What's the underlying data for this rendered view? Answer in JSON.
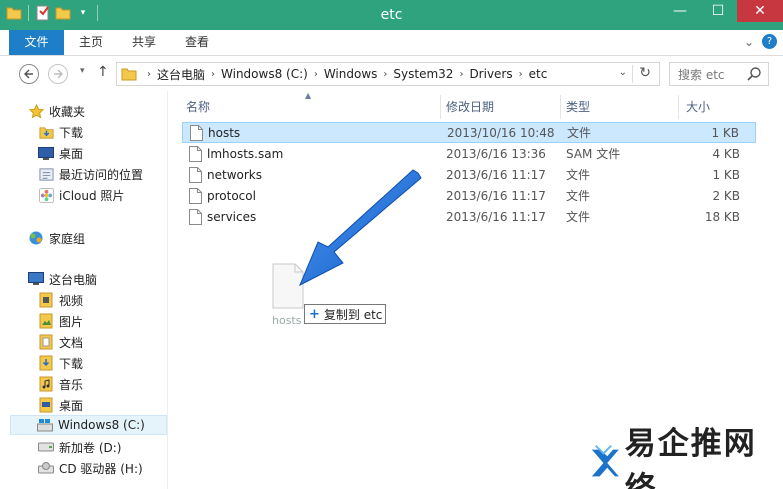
{
  "window": {
    "title": "etc",
    "minimize": "—",
    "maximize": "☐",
    "close": "✕"
  },
  "ribbon": {
    "tabs": [
      "文件",
      "主页",
      "共享",
      "查看"
    ],
    "collapse": "⌄",
    "help": "?"
  },
  "address": {
    "crumbs": [
      "这台电脑",
      "Windows8 (C:)",
      "Windows",
      "System32",
      "Drivers",
      "etc"
    ],
    "search_placeholder": "搜索 etc"
  },
  "columns": {
    "name": "名称",
    "date": "修改日期",
    "type": "类型",
    "size": "大小"
  },
  "files": [
    {
      "name": "hosts",
      "date": "2013/10/16 10:48",
      "type": "文件",
      "size": "1 KB",
      "selected": true
    },
    {
      "name": "lmhosts.sam",
      "date": "2013/6/16 13:36",
      "type": "SAM 文件",
      "size": "4 KB",
      "selected": false
    },
    {
      "name": "networks",
      "date": "2013/6/16 11:17",
      "type": "文件",
      "size": "1 KB",
      "selected": false
    },
    {
      "name": "protocol",
      "date": "2013/6/16 11:17",
      "type": "文件",
      "size": "2 KB",
      "selected": false
    },
    {
      "name": "services",
      "date": "2013/6/16 11:17",
      "type": "文件",
      "size": "18 KB",
      "selected": false
    }
  ],
  "nav": {
    "favorites": {
      "label": "收藏夹",
      "items": [
        "下载",
        "桌面",
        "最近访问的位置",
        "iCloud 照片"
      ]
    },
    "homegroup": "家庭组",
    "pc": {
      "label": "这台电脑",
      "items": [
        "视频",
        "图片",
        "文档",
        "下载",
        "音乐",
        "桌面",
        "Windows8 (C:)",
        "新加卷 (D:)",
        "CD 驱动器 (H:)"
      ]
    }
  },
  "drag": {
    "ghost_label": "hosts",
    "tooltip": "复制到 etc"
  },
  "watermark": {
    "text": "易企推网络"
  },
  "colors": {
    "titlebar": "#2fa37e",
    "file_tab": "#1e7ec8",
    "selection": "#cce8ff",
    "arrow": "#1b6fe0",
    "close": "#c7373f"
  }
}
